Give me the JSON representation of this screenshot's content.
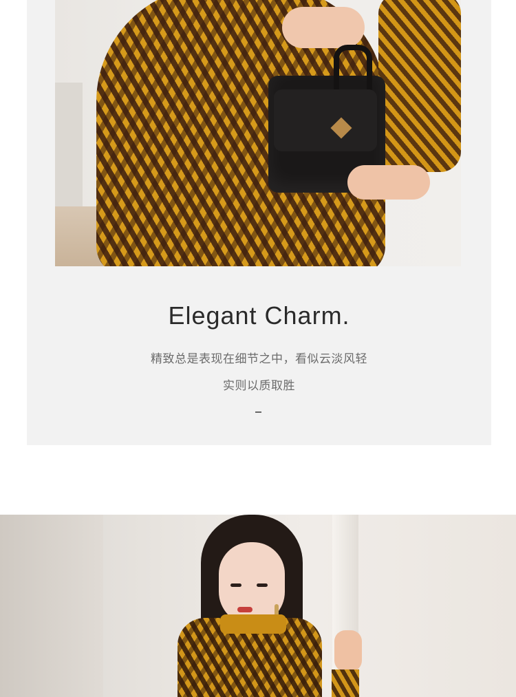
{
  "section": {
    "title": "Elegant Charm.",
    "subtitle_line1": "精致总是表现在细节之中，看似云淡风轻",
    "subtitle_line2": "实则以质取胜",
    "divider": "–"
  },
  "images": {
    "top": "model-holding-black-handbag-yellow-print-dress",
    "bottom": "model-portrait-yellow-print-shirt-dress"
  },
  "colors": {
    "card_bg": "#f2f2f2",
    "title_text": "#2a2a2a",
    "subtitle_text": "#6b6b6b",
    "dress_yellow": "#d69a1b",
    "dress_pattern": "#3c1e0f"
  }
}
